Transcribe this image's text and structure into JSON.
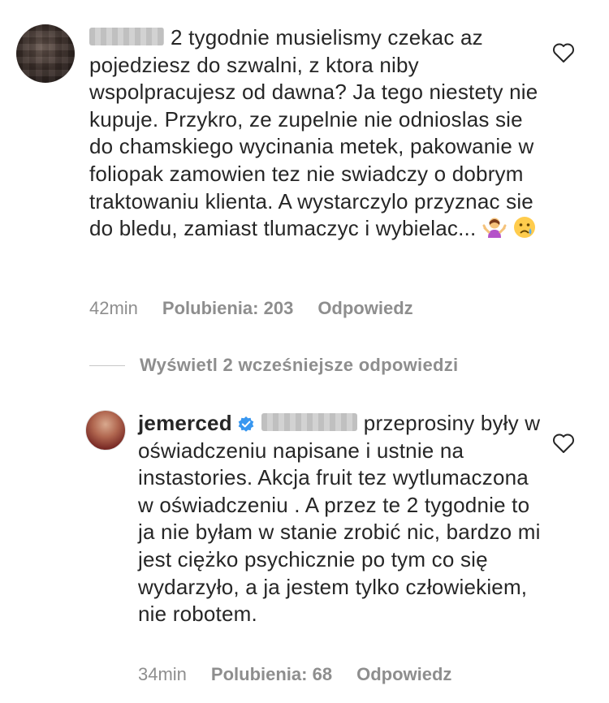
{
  "comment_1": {
    "avatar_icon": "user-avatar-icon",
    "text": "2 tygodnie musielismy czekac az pojedziesz do szwalni, z ktora niby wspolpracujesz od dawna? Ja tego niestety nie kupuje. Przykro, ze zupelnie nie odnioslas sie do chamskiego wycinania metek, pakowanie w foliopak zamowien tez nie swiadczy o dobrym traktowaniu klienta. A wystarczylo przyznac sie do bledu, zamiast tlumaczyc i wybielac...",
    "emoji_1": "🤷‍♀️",
    "emoji_2": "😢",
    "time": "42min",
    "likes": "Polubienia: 203",
    "reply": "Odpowiedz",
    "like_icon": "heart-outline-icon"
  },
  "view_replies": {
    "label": "Wyświetl 2 wcześniejsze odpowiedzi"
  },
  "comment_2": {
    "avatar_icon": "user-avatar-icon",
    "username": "jemerced",
    "verified_icon": "verified-badge-icon",
    "text": "przeprosiny były w oświadczeniu napisane i ustnie na instastories. Akcja fruit tez wytlumaczona w oświadczeniu . A przez te 2 tygodnie to ja nie byłam w stanie zrobić nic, bardzo mi jest ciężko psychicznie po tym co się wydarzyło, a ja jestem tylko człowiekiem, nie robotem.",
    "time": "34min",
    "likes": "Polubienia: 68",
    "reply": "Odpowiedz",
    "like_icon": "heart-outline-icon"
  },
  "colors": {
    "text": "#262626",
    "secondary": "#8e8e8e",
    "verified": "#3897f0"
  }
}
